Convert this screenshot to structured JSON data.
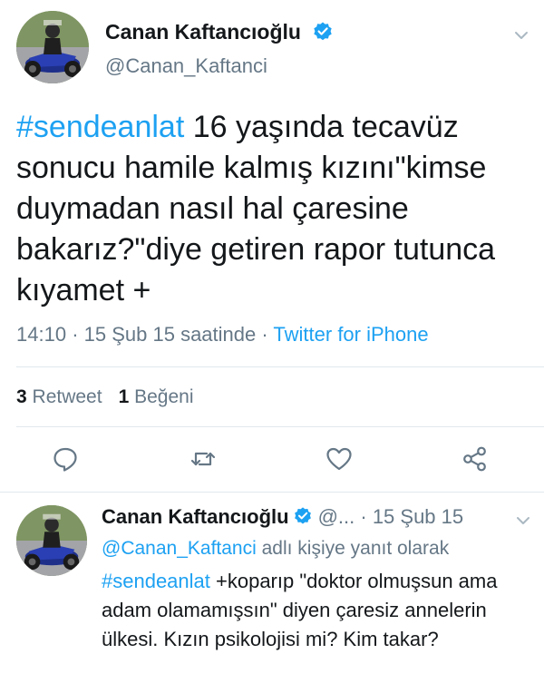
{
  "main_tweet": {
    "author_name": "Canan Kaftancıoğlu",
    "handle": "@Canan_Kaftanci",
    "hashtag": "#sendeanlat",
    "text": " 16 yaşında tecavüz sonucu hamile kalmış kızını\"kimse duymadan nasıl hal çaresine bakarız?\"diye getiren rapor tutunca kıyamet +",
    "time": "14:10",
    "date": "15 Şub 15 saatinde",
    "source": "Twitter for iPhone",
    "retweet_count": "3",
    "retweet_label": "Retweet",
    "like_count": "1",
    "like_label": "Beğeni"
  },
  "reply_tweet": {
    "author_name": "Canan Kaftancıoğlu",
    "handle_truncated": "@...",
    "date": "15 Şub 15",
    "reply_to_handle": "@Canan_Kaftanci",
    "reply_to_suffix": " adlı kişiye yanıt olarak",
    "hashtag": "#sendeanlat",
    "text": " +koparıp \"doktor olmuşsun ama adam olamamışsın\" diyen çaresiz annelerin ülkesi. Kızın psikolojisi mi? Kim takar?"
  },
  "icons": {
    "verified": "verified-badge-icon",
    "chevron": "chevron-down-icon",
    "reply": "reply-icon",
    "retweet": "retweet-icon",
    "like": "heart-icon",
    "share": "share-icon"
  },
  "colors": {
    "accent": "#1da1f2",
    "text": "#14171a",
    "muted": "#657786",
    "divider": "#e1e8ed"
  }
}
